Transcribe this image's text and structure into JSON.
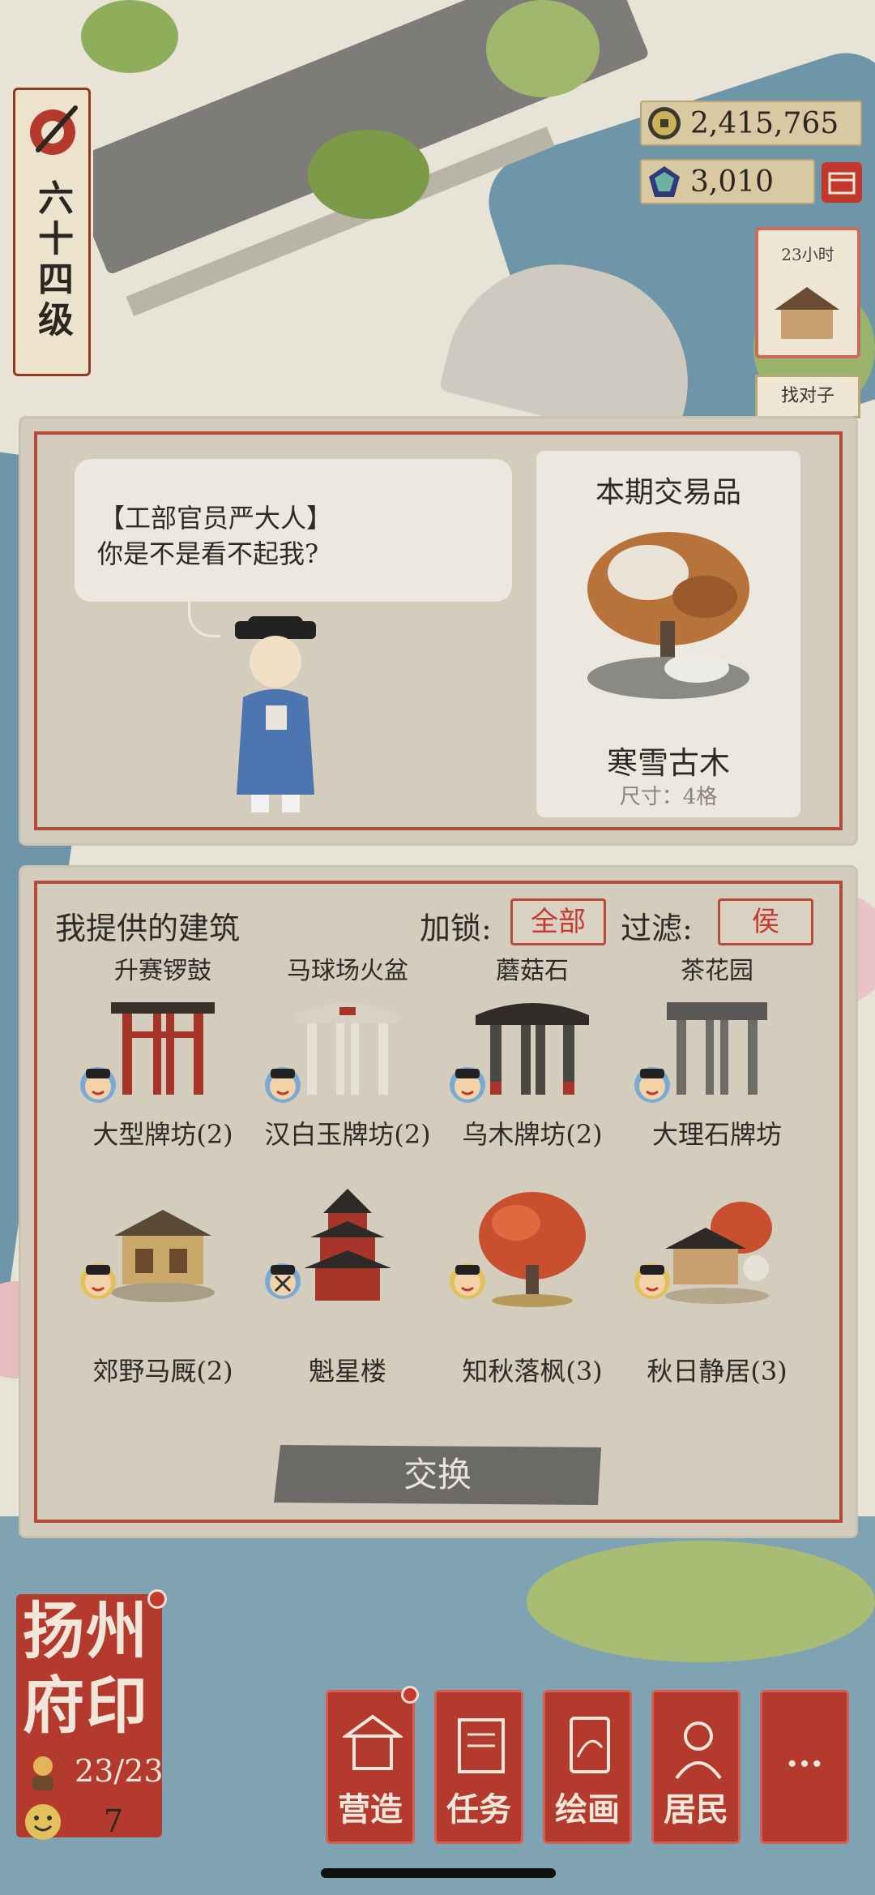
{
  "level": {
    "label": "六十四级"
  },
  "resources": {
    "coins": "2,415,765",
    "gems": "3,010"
  },
  "side": {
    "timer": "23小时",
    "find_label": "找对子"
  },
  "dialog": {
    "speaker": "【工部官员严大人】",
    "line": "你是不是看不起我?"
  },
  "trade_item": {
    "title": "本期交易品",
    "name": "寒雪古木",
    "size": "尺寸：4格"
  },
  "offer": {
    "title": "我提供的建筑",
    "lock_label": "加锁:",
    "lock_value": "全部",
    "filter_label": "过滤:",
    "filter_value": "侯",
    "top_labels": [
      "升赛锣鼓",
      "马球场火盆",
      "蘑菇石",
      "茶花园"
    ],
    "buildings": [
      {
        "name": "大型牌坊(2)"
      },
      {
        "name": "汉白玉牌坊(2)"
      },
      {
        "name": "乌木牌坊(2)"
      },
      {
        "name": "大理石牌坊"
      },
      {
        "name": "郊野马厩(2)"
      },
      {
        "name": "魁星楼"
      },
      {
        "name": "知秋落枫(3)"
      },
      {
        "name": "秋日静居(3)"
      }
    ],
    "exchange_label": "交换"
  },
  "seal": {
    "title": "扬州府印",
    "stat1": "23/23",
    "stat2": "7"
  },
  "nav": [
    {
      "label": "营造"
    },
    {
      "label": "任务"
    },
    {
      "label": "绘画"
    },
    {
      "label": "居民"
    },
    {
      "label": "···"
    }
  ],
  "colors": {
    "accent_red": "#b53a2e",
    "frame_red": "#b84a3c",
    "panel": "#d4ccbd",
    "card": "#ece8df"
  }
}
